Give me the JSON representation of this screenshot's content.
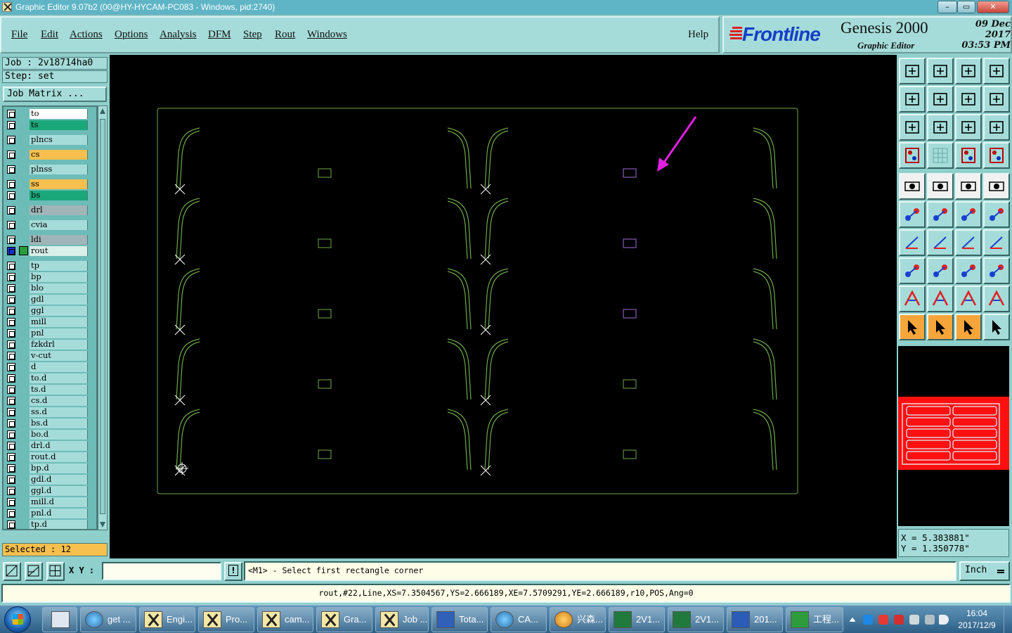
{
  "window": {
    "title": "Graphic Editor 9.07b2 (00@HY-HYCAM-PC083 - Windows, pid:2740)",
    "controls": [
      "–",
      "▭",
      "✕"
    ]
  },
  "menu": [
    "File",
    "Edit",
    "Actions",
    "Options",
    "Analysis",
    "DFM",
    "Step",
    "Rout",
    "Windows"
  ],
  "help_label": "Help",
  "brand": {
    "logo_text": "Frontline",
    "product": "Genesis 2000",
    "subtitle": "Graphic Editor",
    "date": "09 Dec 2017",
    "time": "03:53 PM"
  },
  "job": {
    "job_label": "Job : 2v18714ha0",
    "step_label": "Step: set",
    "matrix_button": "Job Matrix ...",
    "selected": "Selected : 12"
  },
  "layers": [
    {
      "name": "to",
      "color": "#ffffff"
    },
    {
      "name": "ts",
      "color": "#1aa77a"
    },
    {
      "name": "plncs",
      "color": "#a5dcd9"
    },
    {
      "name": "cs",
      "color": "#f7bf4e"
    },
    {
      "name": "plnss",
      "color": "#a5dcd9"
    },
    {
      "name": "ss",
      "color": "#f7bf4e"
    },
    {
      "name": "bs",
      "color": "#1aa77a"
    },
    {
      "name": "drl",
      "color": "#9fb5b7"
    },
    {
      "name": "cvia",
      "color": "#a5dcd9"
    },
    {
      "name": "ldi",
      "color": "#9fb5b7"
    },
    {
      "name": "rout",
      "color": "#d9efe9",
      "active": true
    },
    {
      "name": "tp",
      "color": "#a5dcd9"
    },
    {
      "name": "bp",
      "color": "#a5dcd9"
    },
    {
      "name": "blo",
      "color": "#a5dcd9"
    },
    {
      "name": "gdl",
      "color": "#a5dcd9"
    },
    {
      "name": "ggl",
      "color": "#a5dcd9"
    },
    {
      "name": "mill",
      "color": "#a5dcd9"
    },
    {
      "name": "pnl",
      "color": "#a5dcd9"
    },
    {
      "name": "fzkdrl",
      "color": "#a5dcd9"
    },
    {
      "name": "v-cut",
      "color": "#a5dcd9"
    },
    {
      "name": "d",
      "color": "#a5dcd9"
    },
    {
      "name": "to.d",
      "color": "#a5dcd9"
    },
    {
      "name": "ts.d",
      "color": "#a5dcd9"
    },
    {
      "name": "cs.d",
      "color": "#a5dcd9"
    },
    {
      "name": "ss.d",
      "color": "#a5dcd9"
    },
    {
      "name": "bs.d",
      "color": "#a5dcd9"
    },
    {
      "name": "bo.d",
      "color": "#a5dcd9"
    },
    {
      "name": "drl.d",
      "color": "#a5dcd9"
    },
    {
      "name": "rout.d",
      "color": "#a5dcd9"
    },
    {
      "name": "bp.d",
      "color": "#a5dcd9"
    },
    {
      "name": "gdl.d",
      "color": "#a5dcd9"
    },
    {
      "name": "ggl.d",
      "color": "#a5dcd9"
    },
    {
      "name": "mill.d",
      "color": "#a5dcd9"
    },
    {
      "name": "pnl.d",
      "color": "#a5dcd9"
    },
    {
      "name": "tp.d",
      "color": "#a5dcd9"
    }
  ],
  "canvas_colors": {
    "outline": "#6fa84a",
    "selected": "#a46cd6",
    "pointer_arrow": "#e020e0",
    "cross": "#ffffff"
  },
  "tools": [
    [
      "save-icon",
      "open-icon",
      "home-icon",
      "window-icon"
    ],
    [
      "prev-icon",
      "next-icon",
      "undo-icon",
      "redo-icon"
    ],
    [
      "fit-icon",
      "zoom-icon",
      "scale-icon",
      "help-icon"
    ],
    [
      "snap-icon",
      "grid-icon",
      "layers-icon",
      "filter-icon"
    ],
    [
      "pad-icon",
      "shape-icon",
      "ruler-icon",
      "dot-icon"
    ],
    [
      "node-icon",
      "connect-icon",
      "line-icon",
      "line-add-icon"
    ],
    [
      "angle-icon",
      "slash-icon",
      "arc-icon",
      "mirror-icon"
    ],
    [
      "move-icon",
      "minus-icon",
      "range-icon",
      "copy-icon"
    ],
    [
      "text-icon",
      "text-a-icon",
      "text-b-icon",
      "text-c-icon"
    ],
    [
      "select-icon",
      "select-active-icon",
      "select-orange-icon",
      "route-icon"
    ]
  ],
  "coords": {
    "x": "X = 5.383881\"",
    "y": "Y = 1.350778\""
  },
  "command": {
    "xy_label": "X Y :",
    "xy_value": "",
    "prompt": "<M1> - Select first rectangle corner",
    "unit": "Inch"
  },
  "status": "rout,#22,Line,XS=7.3504567,YS=2.666189,XE=7.5709291,YE=2.666189,r10,POS,Ang=0",
  "taskbar": {
    "items": [
      {
        "label": "",
        "icon": "calc"
      },
      {
        "label": "get ...",
        "icon": "glob"
      },
      {
        "label": "Engi...",
        "icon": "x"
      },
      {
        "label": "Pro...",
        "icon": "x"
      },
      {
        "label": "cam...",
        "icon": "x"
      },
      {
        "label": "Gra...",
        "icon": "x"
      },
      {
        "label": "Job ...",
        "icon": "x"
      },
      {
        "label": "Tota...",
        "icon": "disk"
      },
      {
        "label": "CA...",
        "icon": "glob"
      },
      {
        "label": "兴森...",
        "icon": "shell"
      },
      {
        "label": "2V1...",
        "icon": "xl"
      },
      {
        "label": "2V1...",
        "icon": "xl"
      },
      {
        "label": "201...",
        "icon": "wd"
      },
      {
        "label": "工程...",
        "icon": "f"
      }
    ],
    "clock_time": "16:04",
    "clock_date": "2017/12/9"
  }
}
